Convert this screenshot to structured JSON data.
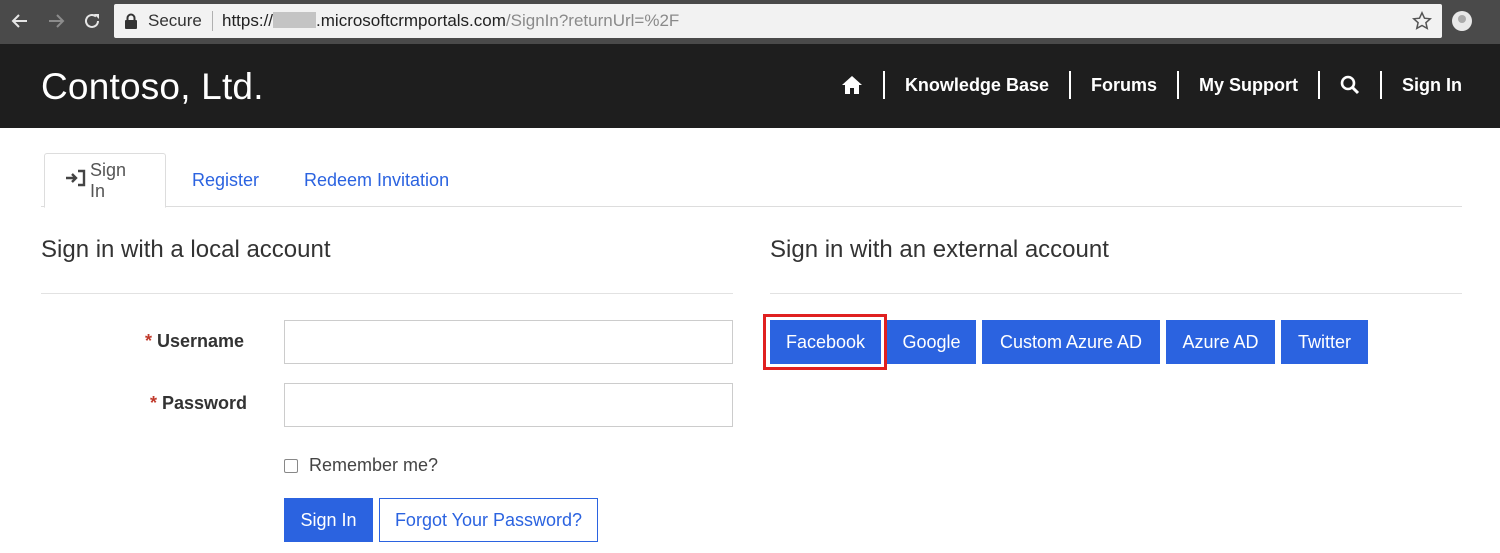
{
  "browser": {
    "secure_label": "Secure",
    "url_prefix": "https://",
    "url_domain": ".microsoftcrmportals.com",
    "url_path": "/SignIn?returnUrl=%2F"
  },
  "site": {
    "brand": "Contoso, Ltd.",
    "nav": {
      "knowledge_base": "Knowledge Base",
      "forums": "Forums",
      "my_support": "My Support",
      "sign_in": "Sign In"
    }
  },
  "tabs": {
    "sign_in": "Sign In",
    "register": "Register",
    "redeem": "Redeem Invitation"
  },
  "local": {
    "title": "Sign in with a local account",
    "required_mark": "*",
    "username_label": "Username",
    "username_value": "",
    "password_label": "Password",
    "password_value": "",
    "remember_label": "Remember me?",
    "signin_button": "Sign In",
    "forgot_button": "Forgot Your Password?"
  },
  "external": {
    "title": "Sign in with an external account",
    "providers": [
      "Facebook",
      "Google",
      "Custom Azure AD",
      "Azure AD",
      "Twitter"
    ]
  },
  "colors": {
    "accent": "#2b63e0",
    "header_bg": "#1e1e1e",
    "highlight": "#e02020"
  },
  "icons": {
    "back": "arrow-left-icon",
    "forward": "arrow-right-icon",
    "reload": "reload-icon",
    "lock": "lock-icon",
    "bookmark": "star-icon",
    "home": "home-icon",
    "search": "search-icon",
    "sign_in": "sign-in-icon"
  }
}
